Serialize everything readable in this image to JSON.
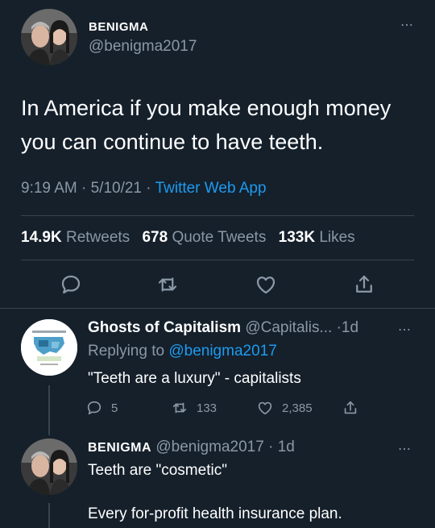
{
  "main_tweet": {
    "display_name": "BENIGMA",
    "handle": "@benigma2017",
    "text_line1": "In America if you make enough money",
    "text_line2": "you can continue to have teeth.",
    "time": "9:19 AM",
    "date": "5/10/21",
    "source": "Twitter Web App",
    "retweets_count": "14.9K",
    "retweets_label": "Retweets",
    "quotes_count": "678",
    "quotes_label": "Quote Tweets",
    "likes_count": "133K",
    "likes_label": "Likes",
    "more_icon": "⋯"
  },
  "reply1": {
    "display_name": "Ghosts of Capitalism",
    "handle": "@Capitalis...",
    "age": "1d",
    "replying_prefix": "Replying to",
    "replying_to": "@benigma2017",
    "text": "\"Teeth are a luxury\" - capitalists",
    "reply_count": "5",
    "retweet_count": "133",
    "like_count": "2,385",
    "more_icon": "⋯"
  },
  "reply2": {
    "display_name": "BENIGMA",
    "handle": "@benigma2017",
    "age": "1d",
    "text_line1": "Teeth are \"cosmetic\"",
    "text_line2": "Every for-profit health insurance plan.",
    "more_icon": "⋯"
  },
  "icons": [
    "reply-icon",
    "retweet-icon",
    "like-icon",
    "share-icon",
    "more-icon"
  ],
  "colors": {
    "background": "#15202b",
    "accent": "#1d9bf0",
    "muted": "#8b98a5",
    "divider": "#38444d"
  }
}
